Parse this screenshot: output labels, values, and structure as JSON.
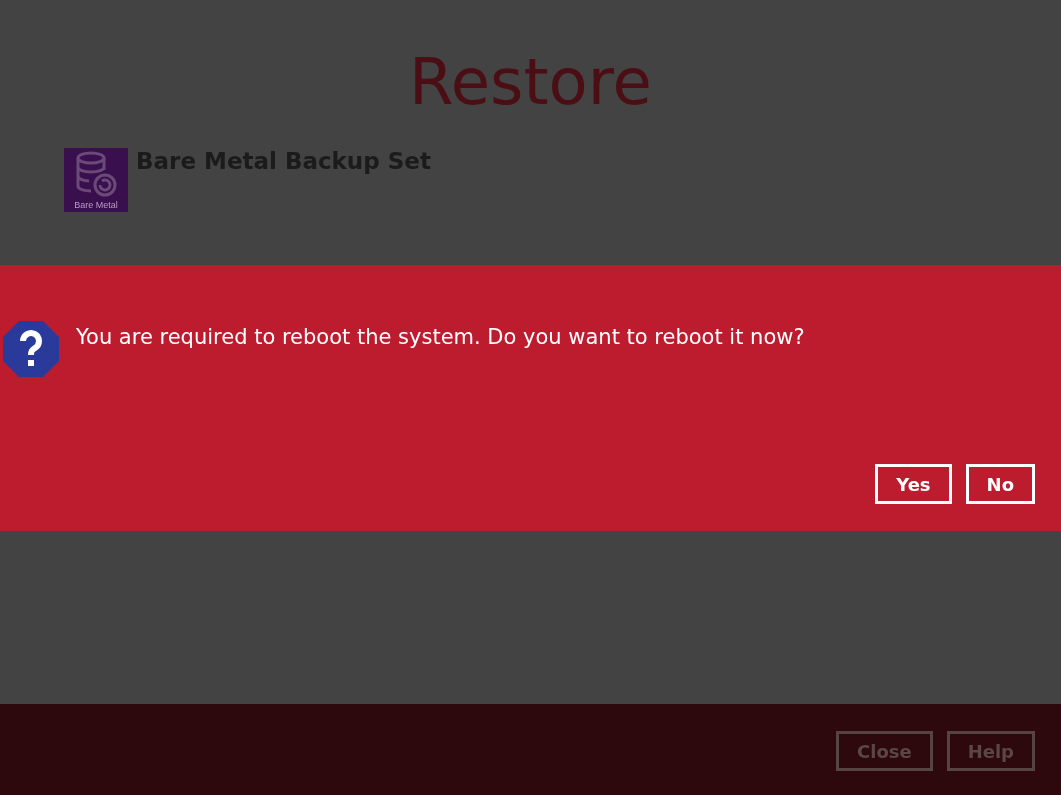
{
  "page": {
    "title": "Restore"
  },
  "backup_set": {
    "icon_label": "Bare Metal",
    "name": "Bare Metal Backup Set"
  },
  "dialog": {
    "message": "You are required to reboot the system. Do you want to reboot it now?",
    "buttons": [
      "Yes",
      "No"
    ]
  },
  "footer": {
    "buttons": [
      "Close",
      "Help"
    ]
  }
}
